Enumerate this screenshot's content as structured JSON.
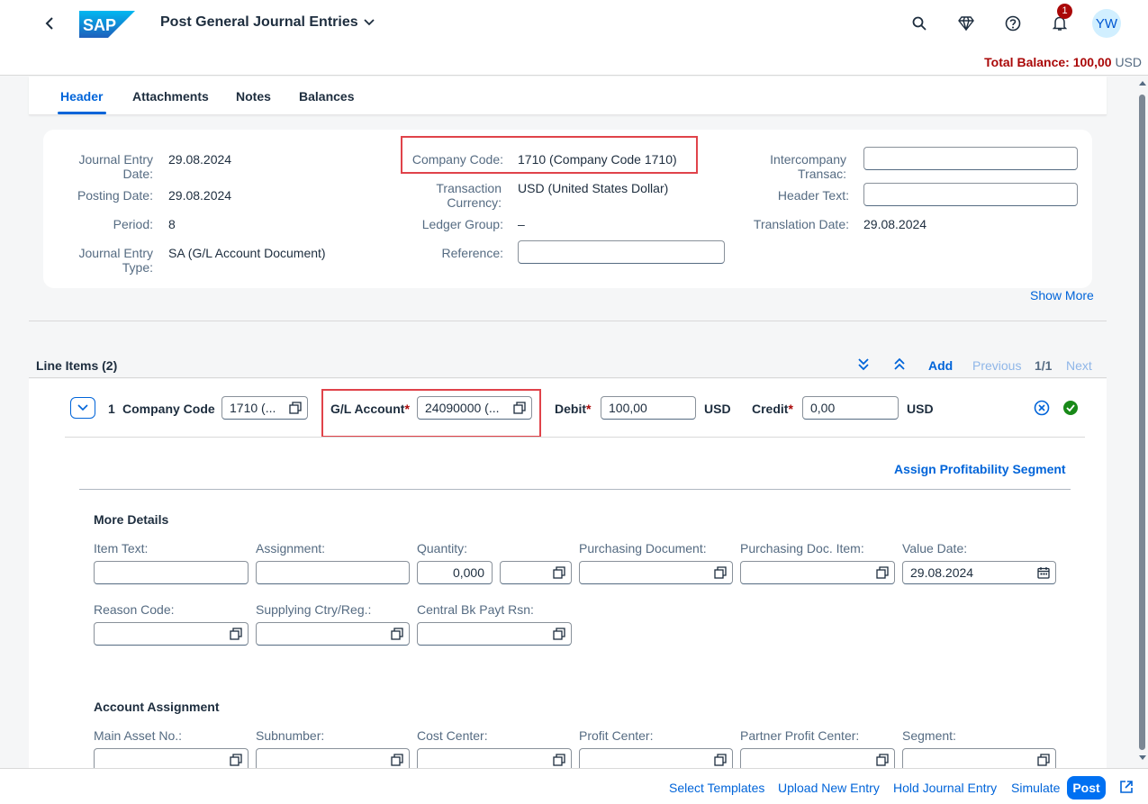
{
  "shell": {
    "app_title": "Post General Journal Entries",
    "logo_text": "SAP",
    "notification_count": "1",
    "avatar_initials": "YW"
  },
  "balance": {
    "label": "Total Balance:",
    "value": "100,00",
    "currency": "USD"
  },
  "tabs": [
    {
      "label": "Header",
      "active": true
    },
    {
      "label": "Attachments"
    },
    {
      "label": "Notes"
    },
    {
      "label": "Balances"
    }
  ],
  "header_form": {
    "journal_entry_date": {
      "label": "Journal Entry Date:",
      "value": "29.08.2024"
    },
    "posting_date": {
      "label": "Posting Date:",
      "value": "29.08.2024"
    },
    "period": {
      "label": "Period:",
      "value": "8"
    },
    "journal_entry_type": {
      "label": "Journal Entry Type:",
      "value": "SA (G/L Account Document)"
    },
    "company_code": {
      "label": "Company Code:",
      "value": "1710 (Company Code 1710)"
    },
    "transaction_currency": {
      "label": "Transaction Currency:",
      "value": "USD (United States Dollar)"
    },
    "ledger_group": {
      "label": "Ledger Group:",
      "value": "–"
    },
    "reference": {
      "label": "Reference:",
      "value": ""
    },
    "intercompany": {
      "label": "Intercompany Transac:",
      "value": ""
    },
    "header_text": {
      "label": "Header Text:",
      "value": ""
    },
    "translation_date": {
      "label": "Translation Date:",
      "value": "29.08.2024"
    },
    "show_more": "Show More"
  },
  "line_items": {
    "title": "Line Items (2)",
    "add": "Add",
    "previous": "Previous",
    "page": "1/1",
    "next": "Next",
    "row": {
      "number": "1",
      "company_code_label": "Company Code",
      "company_code_value": "1710 (...",
      "gl_account_label": "G/L Account",
      "gl_account_value": "24090000 (...",
      "debit_label": "Debit",
      "debit_value": "100,00",
      "debit_currency": "USD",
      "credit_label": "Credit",
      "credit_value": "0,00",
      "credit_currency": "USD",
      "required_mark": "*"
    },
    "assign_profitability": "Assign Profitability Segment",
    "more_details": {
      "title": "More Details",
      "item_text": {
        "label": "Item Text:",
        "value": ""
      },
      "assignment": {
        "label": "Assignment:",
        "value": ""
      },
      "quantity": {
        "label": "Quantity:",
        "value": "0,000"
      },
      "purchasing_document": {
        "label": "Purchasing Document:",
        "value": ""
      },
      "purchasing_doc_item": {
        "label": "Purchasing Doc. Item:",
        "value": ""
      },
      "value_date": {
        "label": "Value Date:",
        "value": "29.08.2024"
      },
      "reason_code": {
        "label": "Reason Code:",
        "value": ""
      },
      "supplying_ctry": {
        "label": "Supplying Ctry/Reg.:",
        "value": ""
      },
      "central_bk": {
        "label": "Central Bk Payt Rsn:",
        "value": ""
      }
    },
    "account_assignment": {
      "title": "Account Assignment",
      "main_asset": {
        "label": "Main Asset No.:"
      },
      "subnumber": {
        "label": "Subnumber:"
      },
      "cost_center": {
        "label": "Cost Center:"
      },
      "profit_center": {
        "label": "Profit Center:"
      },
      "partner_profit_center": {
        "label": "Partner Profit Center:"
      },
      "segment": {
        "label": "Segment:"
      }
    }
  },
  "footer": {
    "select_templates": "Select Templates",
    "upload_new_entry": "Upload New Entry",
    "hold_journal_entry": "Hold Journal Entry",
    "simulate": "Simulate",
    "post": "Post"
  },
  "colors": {
    "accent": "#0064d9",
    "highlight": "#e0434a",
    "balance_red": "#aa0808",
    "success": "#188918"
  }
}
